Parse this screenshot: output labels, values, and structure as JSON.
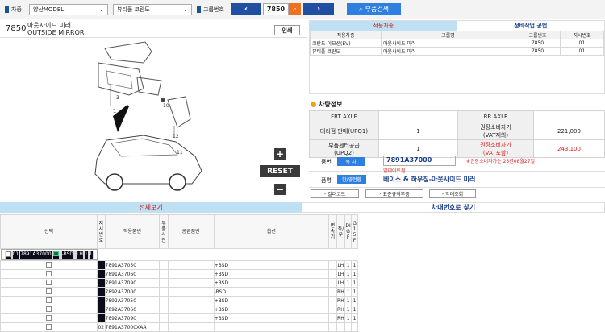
{
  "header": {
    "vehicle_label": "차종",
    "vehicle_value": "양산MODEL",
    "vehicle2_value": "뷰티풀 코란도",
    "group_label": "그룹번호",
    "group_number": "7850",
    "search_label": "부품검색"
  },
  "part": {
    "number": "7850",
    "name_ko": "아웃사이드 미러",
    "name_en": "OUTSIDE MIRROR",
    "print_label": "인쇄",
    "reset_label": "RESET",
    "diagram_callouts": [
      "3",
      "1",
      "10",
      "12",
      "11"
    ]
  },
  "rtabs": {
    "tab1": "적용차종",
    "tab2": "정비작업 공법"
  },
  "apply_table": {
    "headers": [
      "적용차종",
      "그룹명",
      "그룹번호",
      "지시번호"
    ],
    "rows": [
      [
        "코란도 이모션(EV)",
        "아웃사이드 미러",
        "7850",
        "01"
      ],
      [
        "뷰티풀 코란도",
        "아웃사이드 미러",
        "7850",
        "01"
      ]
    ]
  },
  "vehicle_info": {
    "title": "차량정보",
    "frt_axle": "FRT AXLE",
    "rr_axle": "RR AXLE",
    "dot1": ".",
    "dot2": ".",
    "dealer_label": "대리점 판매(UPQ1)",
    "dealer_val": "1",
    "price_label_1": "권장소비자가",
    "price_sub_1": "(VAT제외)",
    "price_1": "221,000",
    "center_label": "부품센터공급",
    "center_label2": "(UPQ2)",
    "center_val": "1",
    "price_label_2": "권장소비자가",
    "price_sub_2": "(VAT포함)",
    "price_2": "243,100",
    "partno_label": "품번",
    "copy_label": "복 사",
    "partno_value": "7891A37000",
    "notice": "※권장소비자가는 25년08월27일",
    "update": "업데이트됨",
    "partname_label": "품명",
    "hangul_label": "한/영전환",
    "partname_value": "베이스 & 하우징-아웃사이드 미러",
    "btn_color": "컬러코드",
    "btn_std": "표준규격부품",
    "btn_size": "악데조회"
  },
  "btabs": {
    "all": "전체보기",
    "vin": "차대번호로 찾기"
  },
  "list_headers": {
    "sel": "선택",
    "idx": "지시번호",
    "part": "적용품번",
    "photo": "부품사진",
    "supply": "공급품번",
    "option": "옵션",
    "conv": "변속기",
    "side": "좌/우",
    "d": "DIGF",
    "g": "G15F"
  },
  "list_rows": [
    {
      "idx": "01",
      "part": "7891A37000",
      "option": "-BSD",
      "side": "LH",
      "d": "1",
      "g": "1"
    },
    {
      "idx": "",
      "part": "7891A37050",
      "option": "+BSD",
      "side": "LH",
      "d": "1",
      "g": "1"
    },
    {
      "idx": "",
      "part": "7891A37060",
      "option": "+BSD",
      "side": "LH",
      "d": "1",
      "g": "1"
    },
    {
      "idx": "",
      "part": "7891A37090",
      "option": "+BSD",
      "side": "LH",
      "d": "1",
      "g": "1"
    },
    {
      "idx": "",
      "part": "7892A37000",
      "option": "-BSD",
      "side": "RH",
      "d": "1",
      "g": "1"
    },
    {
      "idx": "",
      "part": "7892A37050",
      "option": "+BSD",
      "side": "RH",
      "d": "1",
      "g": "1"
    },
    {
      "idx": "",
      "part": "7892A37060",
      "option": "+BSD",
      "side": "RH",
      "d": "1",
      "g": "1"
    },
    {
      "idx": "",
      "part": "7892A37090",
      "option": "+BSD",
      "side": "RH",
      "d": "1",
      "g": "1"
    }
  ],
  "list_tail": {
    "idx": "02",
    "part": "7891A37000XAA"
  }
}
